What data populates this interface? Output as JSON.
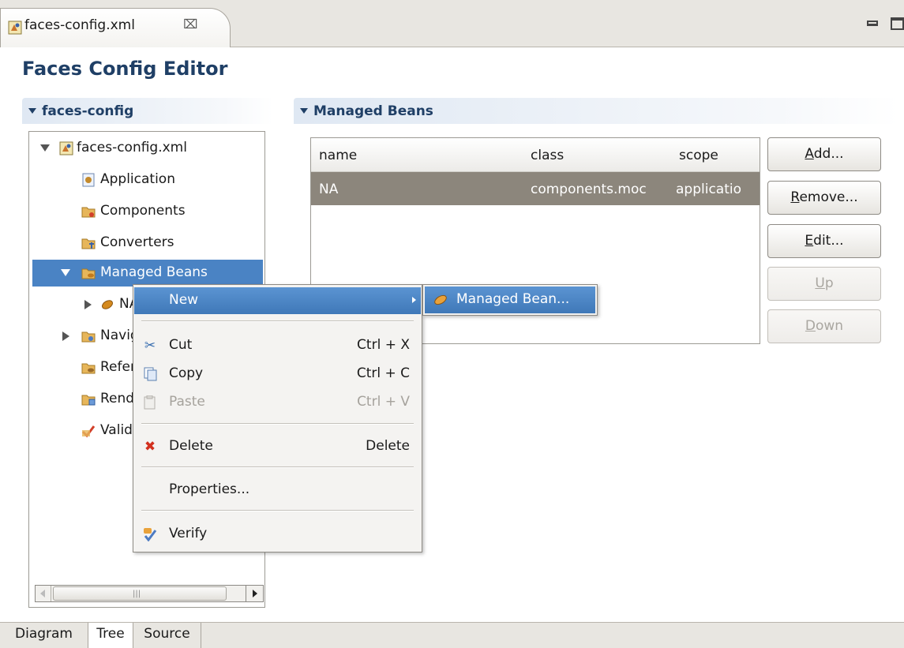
{
  "editor_tab": {
    "label": "faces-config.xml",
    "close_glyph": "⌧"
  },
  "editor_title": "Faces Config Editor",
  "left_section": {
    "title": "faces-config"
  },
  "right_section": {
    "title": "Managed Beans"
  },
  "tree": {
    "items": [
      {
        "label": "faces-config.xml",
        "icon": "faces-config-file-icon",
        "expanded": true
      },
      {
        "label": "Application",
        "icon": "application-icon"
      },
      {
        "label": "Components",
        "icon": "components-folder-icon"
      },
      {
        "label": "Converters",
        "icon": "converters-folder-icon"
      },
      {
        "label": "Managed Beans",
        "icon": "managed-beans-folder-icon",
        "expanded": true,
        "selected": true
      },
      {
        "label": "NA",
        "icon": "bean-icon",
        "expanded": false
      },
      {
        "label": "Navigation Rules",
        "icon": "navigation-folder-icon",
        "expanded": false
      },
      {
        "label": "Referenced Beans",
        "icon": "referenced-beans-folder-icon"
      },
      {
        "label": "Render Kits",
        "icon": "render-kits-folder-icon"
      },
      {
        "label": "Validators",
        "icon": "validators-icon"
      }
    ]
  },
  "table": {
    "columns": [
      "name",
      "class",
      "scope"
    ],
    "rows": [
      {
        "name": "NA",
        "class": "components.moc",
        "scope": "applicatio"
      }
    ]
  },
  "buttons": {
    "add": {
      "label": "Add...",
      "mnemonic": "A"
    },
    "remove": {
      "label": "Remove...",
      "mnemonic": "R"
    },
    "edit": {
      "label": "Edit...",
      "mnemonic": "E"
    },
    "up": {
      "label": "Up",
      "mnemonic": "U"
    },
    "down": {
      "label": "Down",
      "mnemonic": "D"
    }
  },
  "bottom_tabs": [
    "Diagram",
    "Tree",
    "Source"
  ],
  "active_bottom_tab": "Tree",
  "context_menu": {
    "new": {
      "label": "New"
    },
    "cut": {
      "label": "Cut",
      "shortcut": "Ctrl + X"
    },
    "copy": {
      "label": "Copy",
      "shortcut": "Ctrl + C"
    },
    "paste": {
      "label": "Paste",
      "shortcut": "Ctrl + V"
    },
    "delete": {
      "label": "Delete",
      "shortcut": "Delete"
    },
    "properties": {
      "label": "Properties..."
    },
    "verify": {
      "label": "Verify"
    }
  },
  "submenu": {
    "managed_bean": {
      "label": "Managed Bean..."
    }
  },
  "colors": {
    "selection": "#4a83c4",
    "section_title": "#1f3f66",
    "row_selected": "#8c867c"
  }
}
